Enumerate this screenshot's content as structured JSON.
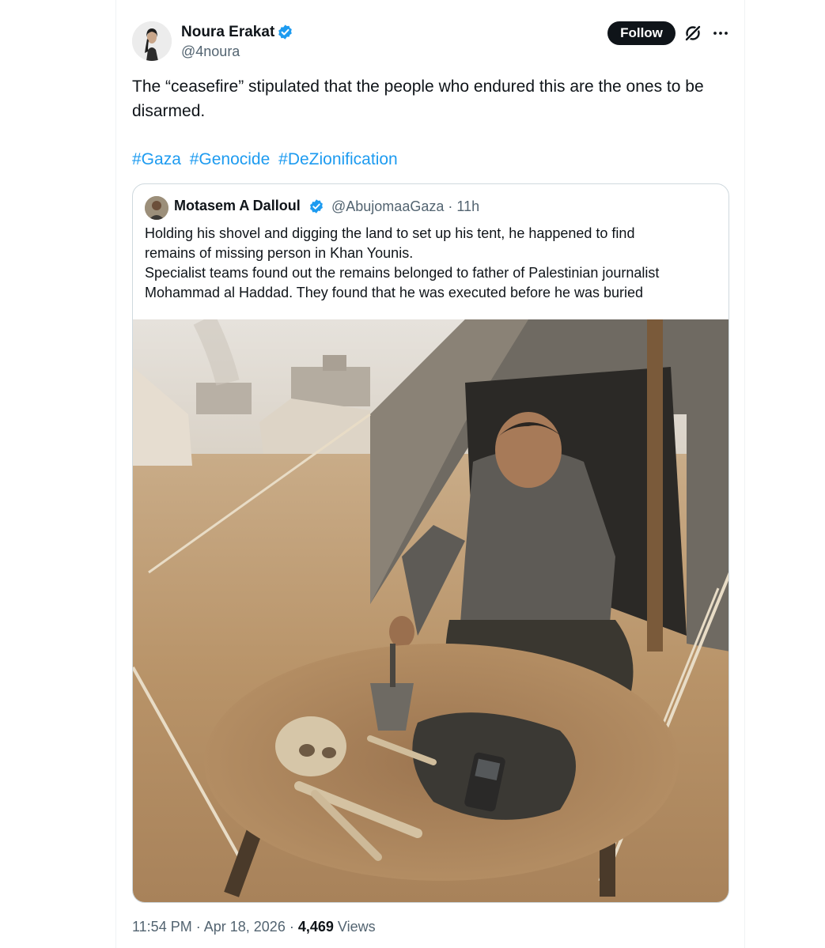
{
  "author": {
    "name": "Noura Erakat",
    "handle": "@4noura"
  },
  "actions": {
    "follow_label": "Follow"
  },
  "tweet": {
    "text": "The “ceasefire” stipulated that the people who endured this are the ones to be disarmed.",
    "hashtags": [
      "#Gaza",
      "#Genocide",
      "#DeZionification"
    ]
  },
  "quoted": {
    "name": "Motasem A Dalloul",
    "handle": "@AbujomaaGaza",
    "separator": "·",
    "time": "11h",
    "text_lines": [
      "Holding his shovel and digging the land to set up his tent, he happened to find",
      "remains of missing person in Khan Younis.",
      "Specialist teams found out the remains belonged to father of Palestinian journalist",
      "Mohammad al Haddad. They found that he was executed before he was buried"
    ]
  },
  "meta": {
    "time": "11:54 PM",
    "dot": "·",
    "date": "Apr 18, 2026",
    "views_count": "4,469",
    "views_label": "Views"
  },
  "colors": {
    "accent": "#1d9bf0",
    "text": "#0f1419",
    "secondary": "#536471",
    "border": "#cfd9de"
  },
  "icons": [
    "verified-badge-icon",
    "grok-icon",
    "more-icon"
  ]
}
